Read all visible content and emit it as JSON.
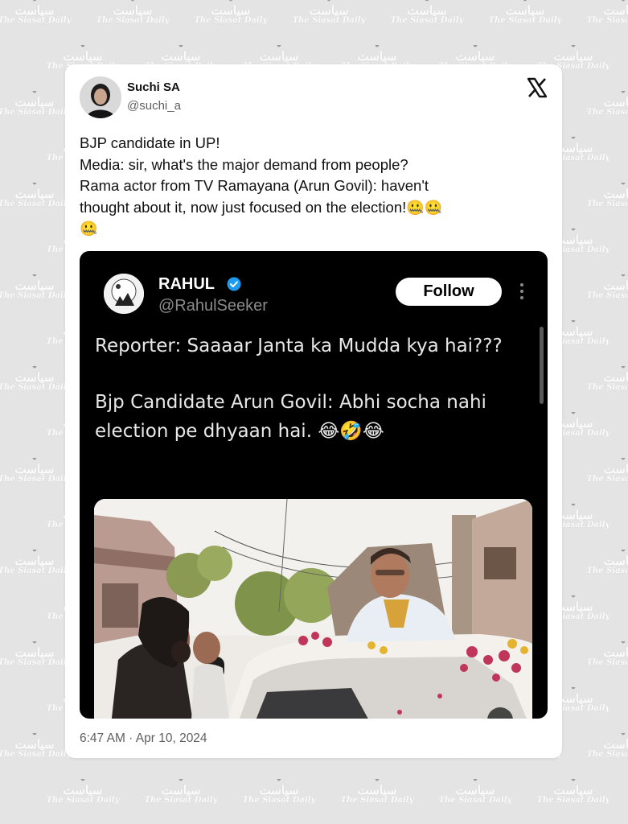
{
  "watermark": {
    "urdu": "سیاست",
    "english": "The Siasat Daily"
  },
  "tweet": {
    "author_name": "Suchi SA",
    "author_handle": "@suchi_a",
    "platform_icon": "x-logo-icon",
    "text_lines": [
      "BJP candidate in UP!",
      "Media: sir, what's the major demand from people?",
      "Rama actor from TV Ramayana (Arun Govil): haven't",
      "thought about it, now just focused on the election!"
    ],
    "line_end_emojis": "🤐🤐",
    "last_line_emoji": "🤐",
    "timestamp": "6:47 AM · Apr 10, 2024"
  },
  "embedded": {
    "author_name": "RAHUL",
    "author_handle": "@RahulSeeker",
    "verified_icon": "verified-badge-icon",
    "follow_label": "Follow",
    "more_icon": "more-vertical-icon",
    "paragraph_1": "Reporter: Saaaar Janta ka Mudda kya hai???",
    "paragraph_2_text": "Bjp Candidate Arun Govil: Abhi socha nahi election pe dhyaan hai.",
    "paragraph_2_emojis": " 😂🤣😂",
    "media_description_icon": "video-thumbnail"
  },
  "colors": {
    "page_bg": "#e4e4e4",
    "card_bg": "#ffffff",
    "embed_bg": "#000000",
    "verified": "#1d9bf0"
  }
}
